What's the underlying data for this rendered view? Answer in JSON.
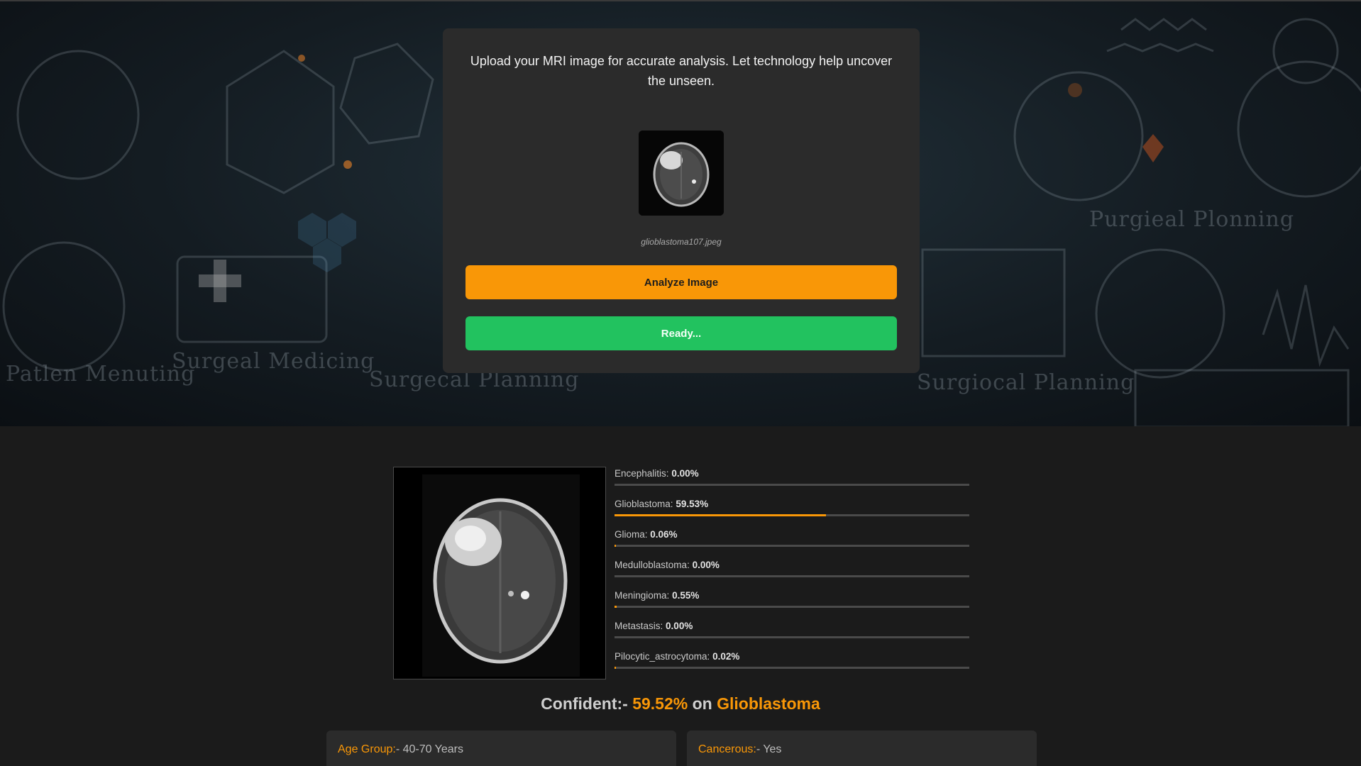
{
  "background": {
    "words": [
      "Patlen Menuting",
      "Surgeal Medicing",
      "Surgecal Planning",
      "Surgiocal Planning",
      "Purgieal Plonning"
    ]
  },
  "upload": {
    "message": "Upload your MRI image for accurate analysis. Let technology help uncover the unseen.",
    "filename": "glioblastoma107.jpeg",
    "analyze_label": "Analyze Image",
    "status_label": "Ready..."
  },
  "results": {
    "predictions": [
      {
        "label": "Encephalitis",
        "value": "0.00%",
        "fraction": 0.0
      },
      {
        "label": "Glioblastoma",
        "value": "59.53%",
        "fraction": 0.5953
      },
      {
        "label": "Glioma",
        "value": "0.06%",
        "fraction": 0.0006
      },
      {
        "label": "Medulloblastoma",
        "value": "0.00%",
        "fraction": 0.0
      },
      {
        "label": "Meningioma",
        "value": "0.55%",
        "fraction": 0.0055
      },
      {
        "label": "Metastasis",
        "value": "0.00%",
        "fraction": 0.0
      },
      {
        "label": "Pilocytic_astrocytoma",
        "value": "0.02%",
        "fraction": 0.0002
      }
    ],
    "confident_prefix": "Confident:-",
    "confident_value": "59.52%",
    "confident_on": "on",
    "confident_class": "Glioblastoma",
    "info": [
      {
        "key": "Age Group:",
        "value": "- 40-70 Years"
      },
      {
        "key": "Cancerous:",
        "value": "- Yes"
      }
    ]
  },
  "colors": {
    "accent": "#f99707",
    "success": "#22c25f"
  }
}
